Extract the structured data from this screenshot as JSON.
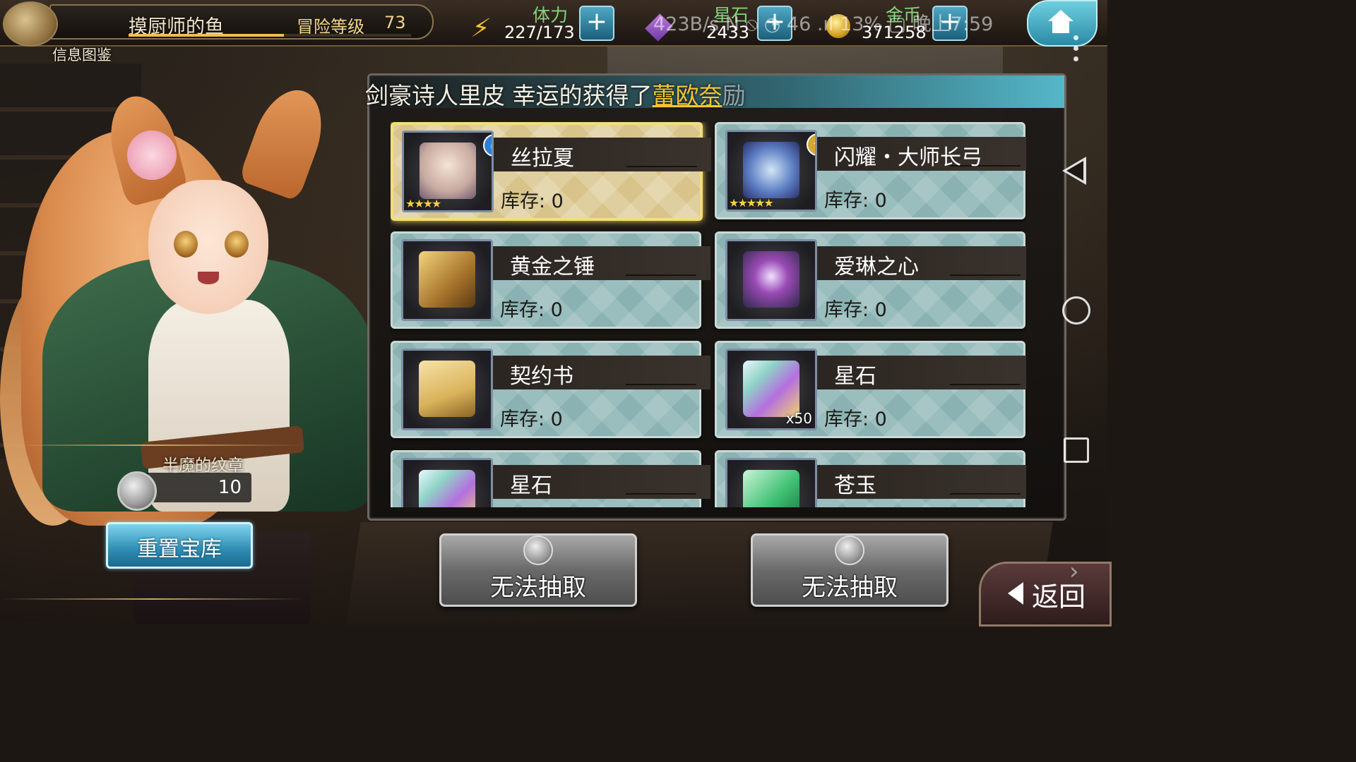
{
  "header": {
    "player_name": "摸厨师的鱼",
    "level_label": "冒险等级",
    "level_value": "73",
    "info_label": "信息图鉴",
    "exp_progress": 0.55
  },
  "resources": {
    "stamina": {
      "label": "体力",
      "value": "227/173",
      "icon": "lightning-icon"
    },
    "gems": {
      "label": "星石",
      "value": "2433",
      "icon": "gem-icon"
    },
    "gold": {
      "label": "金币",
      "value": "371258",
      "icon": "coin-icon"
    }
  },
  "status_overlay": "423B/s  N  ⦸  ◔  46  .ıl 13%  ▢  晚上7:59",
  "marquee": {
    "prefix": "剑豪诗人里皮 幸运的获得了",
    "highlight": "蕾欧奈",
    "suffix": "励"
  },
  "items": [
    {
      "name": "丝拉夏",
      "stock": "库存: 0",
      "stars": "★★★★",
      "count": "",
      "badge": "💧",
      "badge_color": "#2f7fd0",
      "selected": true,
      "art": "character-portrait"
    },
    {
      "name": "闪耀・大师长弓",
      "stock": "库存: 0",
      "stars": "★★★★★",
      "count": "",
      "badge": "✸",
      "badge_color": "#d6a630",
      "selected": false,
      "art": "bow"
    },
    {
      "name": "黄金之锤",
      "stock": "库存: 0",
      "stars": "",
      "count": "",
      "badge": "",
      "selected": false,
      "art": "hammer"
    },
    {
      "name": "爱琳之心",
      "stock": "库存: 0",
      "stars": "",
      "count": "",
      "badge": "",
      "selected": false,
      "art": "gem-heart"
    },
    {
      "name": "契约书",
      "stock": "库存: 0",
      "stars": "",
      "count": "",
      "badge": "",
      "selected": false,
      "art": "scroll"
    },
    {
      "name": "星石",
      "stock": "库存: 0",
      "stars": "",
      "count": "x50",
      "badge": "",
      "selected": false,
      "art": "star-stone"
    },
    {
      "name": "星石",
      "stock": "",
      "stars": "",
      "count": "",
      "badge": "",
      "selected": false,
      "art": "star-stone"
    },
    {
      "name": "苍玉",
      "stock": "",
      "stars": "",
      "count": "",
      "badge": "",
      "selected": false,
      "art": "jade"
    }
  ],
  "emblem": {
    "label": "半魔的纹章",
    "count": "10"
  },
  "buttons": {
    "reset": "重置宝库",
    "draw_one": "无法抽取",
    "draw_two": "无法抽取",
    "back": "返回"
  },
  "colors": {
    "accent_cyan": "#2f8db3",
    "highlight_gold": "#f5c531",
    "card_teal": "#8ab2b2",
    "card_selected": "#d8c48a"
  }
}
